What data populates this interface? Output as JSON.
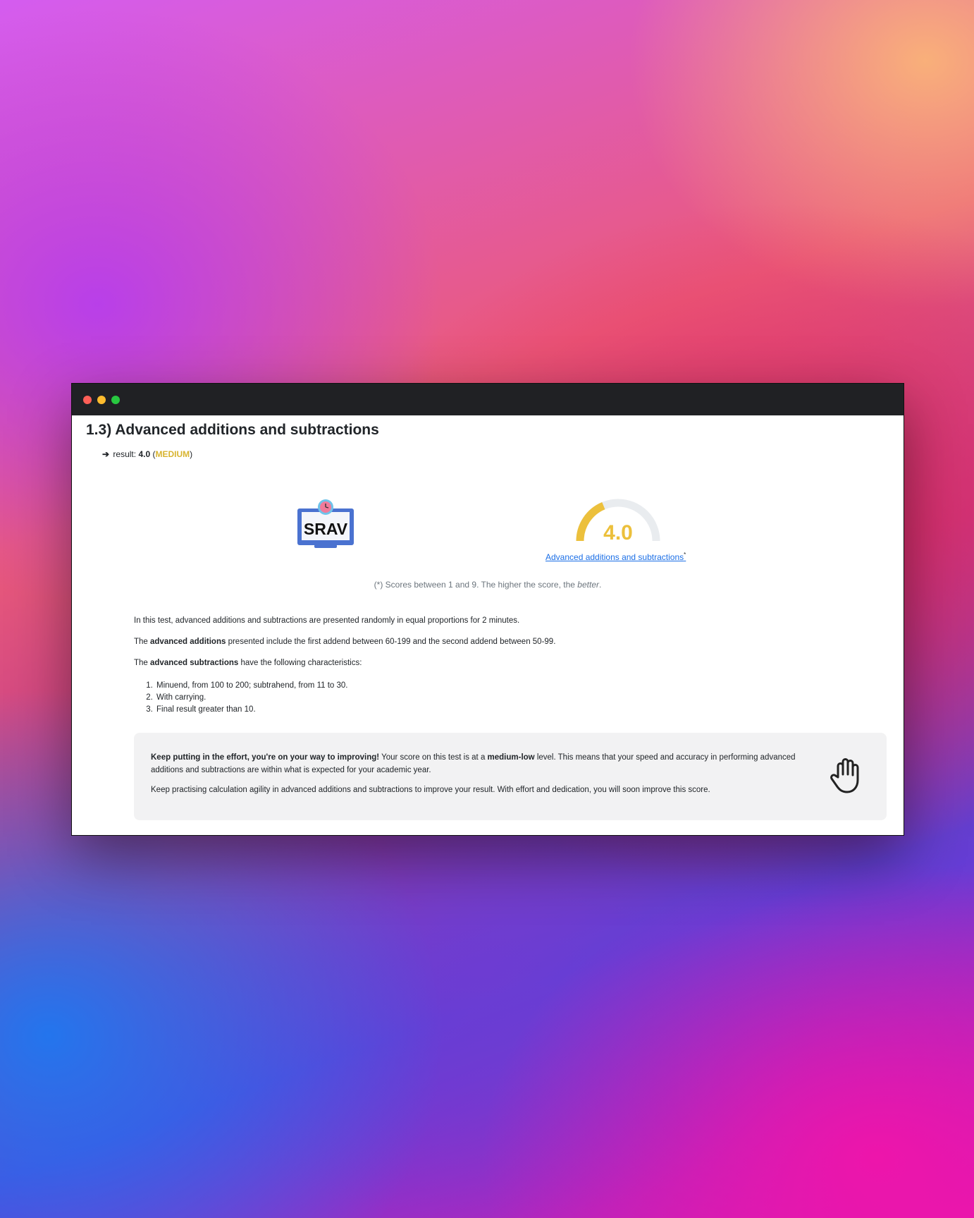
{
  "window": {
    "controls": [
      "close",
      "minimize",
      "maximize"
    ]
  },
  "section": {
    "title": "1.3) Advanced additions and subtractions",
    "result_arrow": "➔",
    "result_label": "result:",
    "result_score": "4.0",
    "result_open": "(",
    "result_level": "MEDIUM",
    "result_close": ")"
  },
  "logo": {
    "text": "SRAV",
    "icon": "monitor-with-stopwatch-icon"
  },
  "gauge": {
    "value": "4.0",
    "fraction": 0.375,
    "min": 1,
    "max": 9,
    "color": "#ecc03c",
    "track_color": "#e9ecef",
    "link_text": "Advanced additions and subtractions",
    "asterisk": "*"
  },
  "note": {
    "text_before": "(*) Scores between 1 and 9. The higher the score, the ",
    "emphasis": "better",
    "text_after": "."
  },
  "description": {
    "p1": "In this test, advanced additions and subtractions are presented randomly in equal proportions for 2 minutes.",
    "p2_before": "The ",
    "p2_bold": "advanced additions",
    "p2_after": " presented include the first addend between 60-199 and the second addend between 50-99.",
    "p3_before": "The ",
    "p3_bold": "advanced subtractions",
    "p3_after": " have the following characteristics:",
    "rules": [
      "Minuend, from 100 to 200; subtrahend, from 11 to 30.",
      "With carrying.",
      "Final result greater than 10."
    ]
  },
  "feedback": {
    "lead_bold": "Keep putting in the effort, you're on your way to improving!",
    "text1": " Your score on this test is at a ",
    "level_bold": "medium-low",
    "text2": " level. This means that your speed and accuracy in performing advanced additions and subtractions are within what is expected for your academic year.",
    "p2": "Keep practising calculation agility in advanced additions and subtractions to improve your result. With effort and dedication, you will soon improve this score.",
    "icon": "raised-hand-icon"
  }
}
